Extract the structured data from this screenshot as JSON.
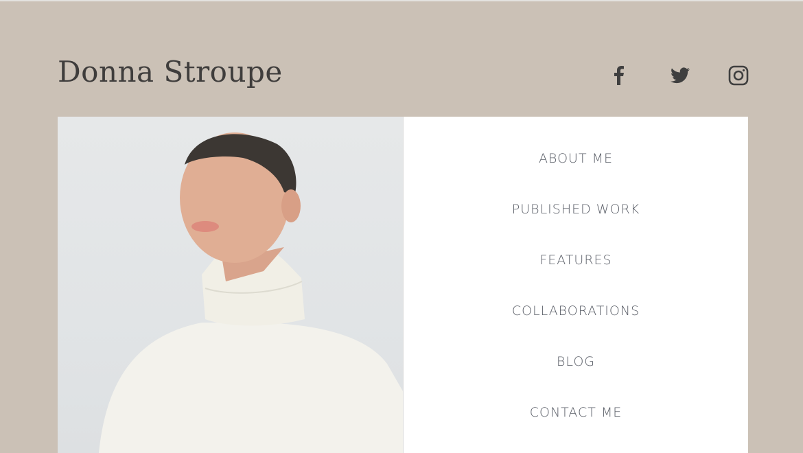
{
  "header": {
    "site_title": "Donna Stroupe"
  },
  "social": [
    {
      "icon": "facebook-icon"
    },
    {
      "icon": "twitter-icon"
    },
    {
      "icon": "instagram-icon"
    }
  ],
  "nav": {
    "items": [
      "ABOUT ME",
      "PUBLISHED WORK",
      "FEATURES",
      "COLLABORATIONS",
      "BLOG",
      "CONTACT ME"
    ]
  },
  "colors": {
    "background": "#cbc1b6",
    "text": "#3f3d3c",
    "nav_text": "#5b5f68",
    "card": "#ffffff"
  }
}
